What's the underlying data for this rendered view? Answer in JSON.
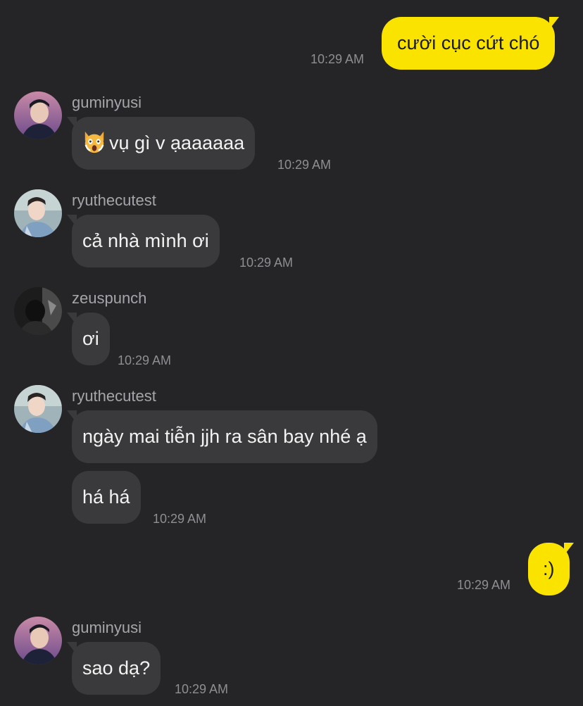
{
  "messages": [
    {
      "sender": "me",
      "text": "cười cục cứt chó",
      "time": "10:29 AM"
    },
    {
      "sender": "guminyusi",
      "text": "vụ gì v ạaaaaaa",
      "emoji": "scream-cat-emoji",
      "time": "10:29 AM"
    },
    {
      "sender": "ryuthecutest",
      "text": "cả nhà mình ơi",
      "time": "10:29 AM"
    },
    {
      "sender": "zeuspunch",
      "text": "ơi",
      "time": "10:29 AM"
    },
    {
      "sender": "ryuthecutest",
      "text": "ngày mai tiễn jjh ra sân bay nhé ạ"
    },
    {
      "sender": "ryuthecutest",
      "text": "há há",
      "time": "10:29 AM"
    },
    {
      "sender": "me",
      "text": ":)",
      "time": "10:29 AM"
    },
    {
      "sender": "guminyusi",
      "text": "sao dạ?",
      "time": "10:29 AM"
    }
  ],
  "colors": {
    "background": "#252527",
    "outgoing_bubble": "#FBE300",
    "incoming_bubble": "#3A3A3C"
  }
}
